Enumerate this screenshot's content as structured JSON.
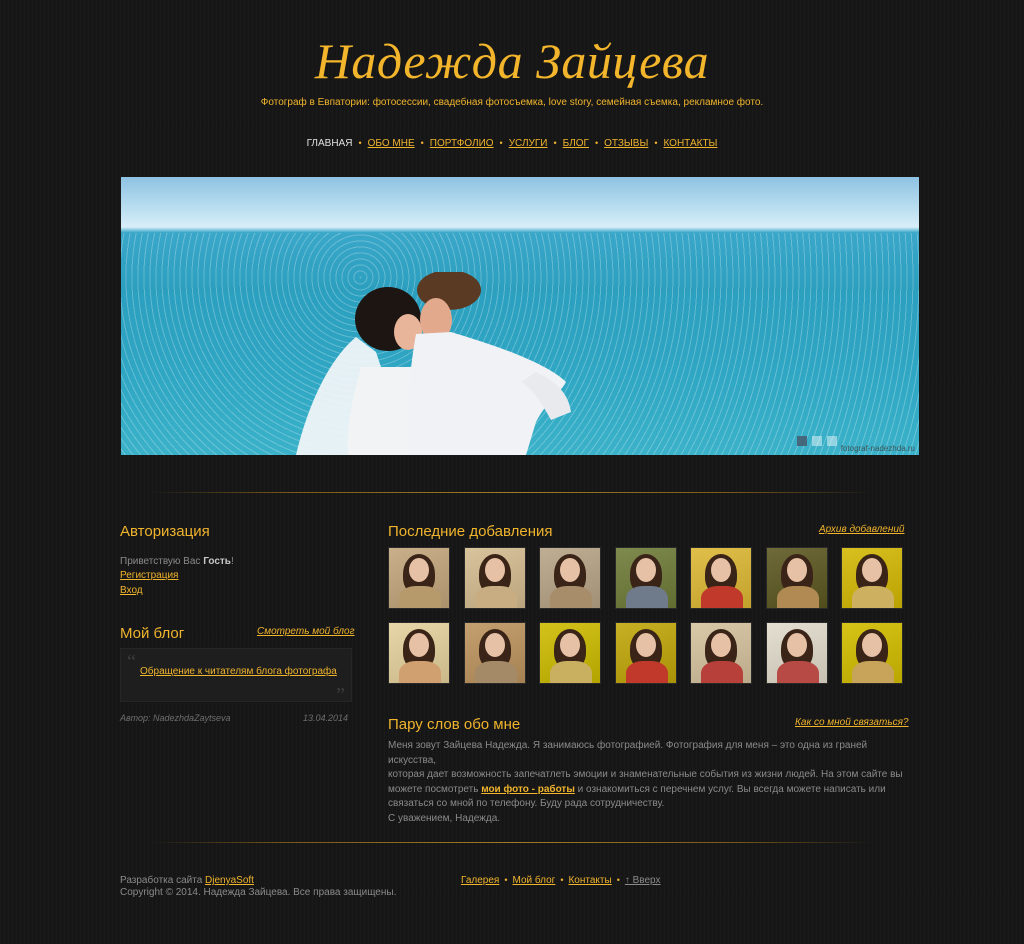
{
  "header": {
    "title": "Надежда Зайцева",
    "tagline": "Фотограф в Евпатории: фотосессии, свадебная фотосъемка, love story, семейная съемка, рекламное фото."
  },
  "nav": {
    "items": [
      {
        "label": "ГЛАВНАЯ",
        "active": true
      },
      {
        "label": "ОБО МНЕ"
      },
      {
        "label": "ПОРТФОЛИО"
      },
      {
        "label": "УСЛУГИ"
      },
      {
        "label": "БЛОГ"
      },
      {
        "label": "ОТЗЫВЫ"
      },
      {
        "label": "КОНТАКТЫ"
      }
    ],
    "separator": "•"
  },
  "hero": {
    "credit": "fotograf-nadezhda.ru",
    "slides": 3,
    "active_slide": 1
  },
  "auth": {
    "title": "Авторизация",
    "greeting": "Приветствую Вас",
    "guest": "Гость",
    "exclaim": "!",
    "register": "Регистрация",
    "login": "Вход"
  },
  "blog": {
    "title": "Мой блог",
    "view_link": "Смотреть мой блог",
    "post_title": "Обращение к читателям блога фотографа",
    "author": "Автор: NadezhdaZaytseva",
    "date": "13.04.2014"
  },
  "latest": {
    "title": "Последние добавления",
    "archive_link": "Архив добавлений",
    "thumbs": [
      {
        "bg": "#c9b08a",
        "dress": "#b79a6b"
      },
      {
        "bg": "#d9c39c",
        "dress": "#c8ad82"
      },
      {
        "bg": "#bfae94",
        "dress": "#a78d6a"
      },
      {
        "bg": "#7f8a4e",
        "dress": "#6f7a8a"
      },
      {
        "bg": "#e0c04a",
        "dress": "#c0392b"
      },
      {
        "bg": "#6e6a3a",
        "dress": "#b08a52"
      },
      {
        "bg": "#d8c020",
        "dress": "#cdb060"
      },
      {
        "bg": "#e7d7a8",
        "dress": "#d0a070"
      },
      {
        "bg": "#c4a070",
        "dress": "#a58a68"
      },
      {
        "bg": "#d2c21a",
        "dress": "#c8b060"
      },
      {
        "bg": "#c8b025",
        "dress": "#c0392b"
      },
      {
        "bg": "#d9c9a8",
        "dress": "#b8403a"
      },
      {
        "bg": "#e4dfd0",
        "dress": "#b84a46"
      },
      {
        "bg": "#d7c417",
        "dress": "#c8a45a"
      }
    ]
  },
  "about": {
    "title": "Пару слов обо мне",
    "contact_link": "Как со мной связаться?",
    "p1": "Меня зовут Зайцева Надежда. Я занимаюсь фотографией. Фотография для меня – это одна из граней искусства,",
    "p2": "которая дает возможность запечатлеть эмоции и знаменательные события из жизни людей. На этом сайте вы",
    "p3a": "можете посмотреть",
    "p3link": "мои фото - работы",
    "p3b": "и ознакомиться с перечнем услуг. Вы всегда можете написать или",
    "p4": "связаться со мной по телефону. Буду рада сотрудничеству.",
    "p5": "С уважением, Надежда."
  },
  "footer": {
    "dev_label": "Разработка сайта",
    "dev_link": "DjenyaSoft",
    "copyright": "Copyright © 2014. Надежда Зайцева. Все права защищены.",
    "links": [
      "Галерея",
      "Мой блог",
      "Контакты"
    ],
    "up": "↑ Вверх"
  },
  "colors": {
    "accent": "#f0b42d",
    "background": "#161616"
  }
}
